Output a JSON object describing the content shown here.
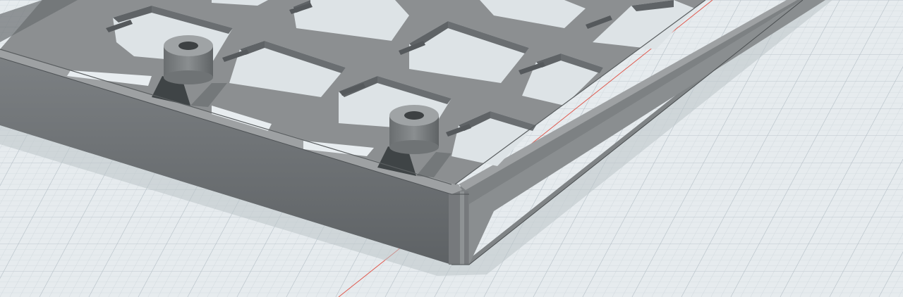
{
  "viewport": {
    "kind": "cad-3d-viewport",
    "background_color": "#e6ebee",
    "grid_minor_color": "#cfd7dc",
    "grid_major_color": "#b3bec5",
    "axis_color": "#e05a4f"
  },
  "model": {
    "kind": "keyboard-plate-case-corner",
    "shown_key_openings": 10,
    "shown_standoffs": 2,
    "colors": {
      "top_face": "#8c8f91",
      "inner_top": "#9a9d9f",
      "wall_front": "#6e7275",
      "wall_side": "#85898b",
      "floor_through_holes": "#dde3e6",
      "hole_walls": "#6a6e71",
      "standoff_body": "#7a7e80",
      "standoff_top": "#9fa3a5",
      "shadow": "#3f4446"
    }
  }
}
